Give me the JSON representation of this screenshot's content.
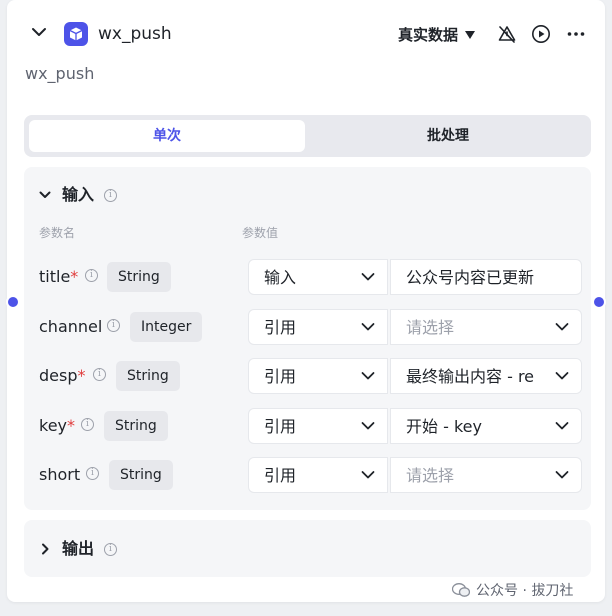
{
  "node": {
    "title": "wx_push",
    "description": "wx_push",
    "mode_label": "真实数据",
    "accent_color": "#4d53e8",
    "icons": [
      "collapse-chevron-icon",
      "cube-icon",
      "caret-down-icon",
      "warning-off-icon",
      "play-icon",
      "more-icon"
    ]
  },
  "tabs": [
    {
      "label": "单次",
      "active": true
    },
    {
      "label": "批处理",
      "active": false
    }
  ],
  "input_section": {
    "title": "输入",
    "col_name": "参数名",
    "col_value": "参数值",
    "rows": [
      {
        "name": "title",
        "required": true,
        "type": "String",
        "source": "输入",
        "value": "公众号内容已更新",
        "placeholder": false
      },
      {
        "name": "channel",
        "required": false,
        "type": "Integer",
        "source": "引用",
        "value": "请选择",
        "placeholder": true
      },
      {
        "name": "desp",
        "required": true,
        "type": "String",
        "source": "引用",
        "value": "最终输出内容 - re",
        "placeholder": false
      },
      {
        "name": "key",
        "required": true,
        "type": "String",
        "source": "引用",
        "value": "开始 - key",
        "placeholder": false
      },
      {
        "name": "short",
        "required": false,
        "type": "String",
        "source": "引用",
        "value": "请选择",
        "placeholder": true
      }
    ]
  },
  "output_section": {
    "title": "输出"
  },
  "required_mark": "*",
  "watermark": "公众号 · 拔刀社"
}
